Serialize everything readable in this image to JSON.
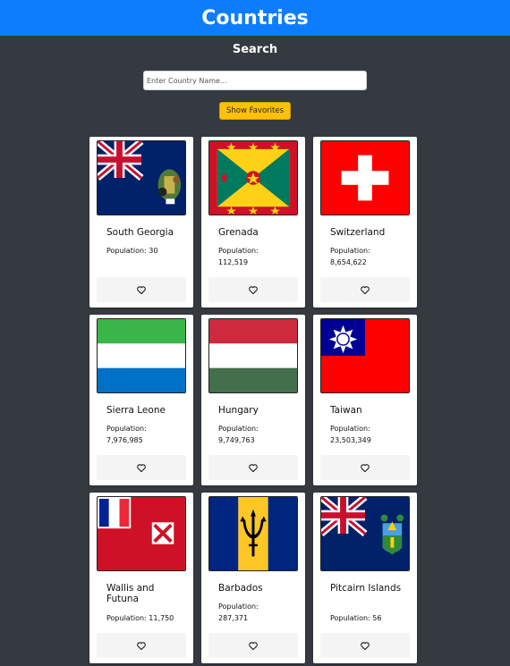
{
  "header": {
    "title": "Countries"
  },
  "search": {
    "title": "Search",
    "placeholder": "Enter Country Name..."
  },
  "favorites_button": {
    "label": "Show Favorites"
  },
  "countries": [
    {
      "name": "South Georgia",
      "population_label": "Population:",
      "population": "30"
    },
    {
      "name": "Grenada",
      "population_label": "Population:",
      "population": "112,519"
    },
    {
      "name": "Switzerland",
      "population_label": "Population:",
      "population": "8,654,622"
    },
    {
      "name": "Sierra Leone",
      "population_label": "Population:",
      "population": "7,976,985"
    },
    {
      "name": "Hungary",
      "population_label": "Population:",
      "population": "9,749,763"
    },
    {
      "name": "Taiwan",
      "population_label": "Population:",
      "population": "23,503,349"
    },
    {
      "name": "Wallis and Futuna",
      "population_label": "Population:",
      "population": "11,750"
    },
    {
      "name": "Barbados",
      "population_label": "Population:",
      "population": "287,371"
    },
    {
      "name": "Pitcairn Islands",
      "population_label": "Population:",
      "population": "56"
    }
  ],
  "colors": {
    "header_bg": "#0d7dfd",
    "page_bg": "#343a40",
    "favorites_bg": "#ffc107"
  },
  "icons": {
    "favorite": "heart-outline-icon"
  }
}
